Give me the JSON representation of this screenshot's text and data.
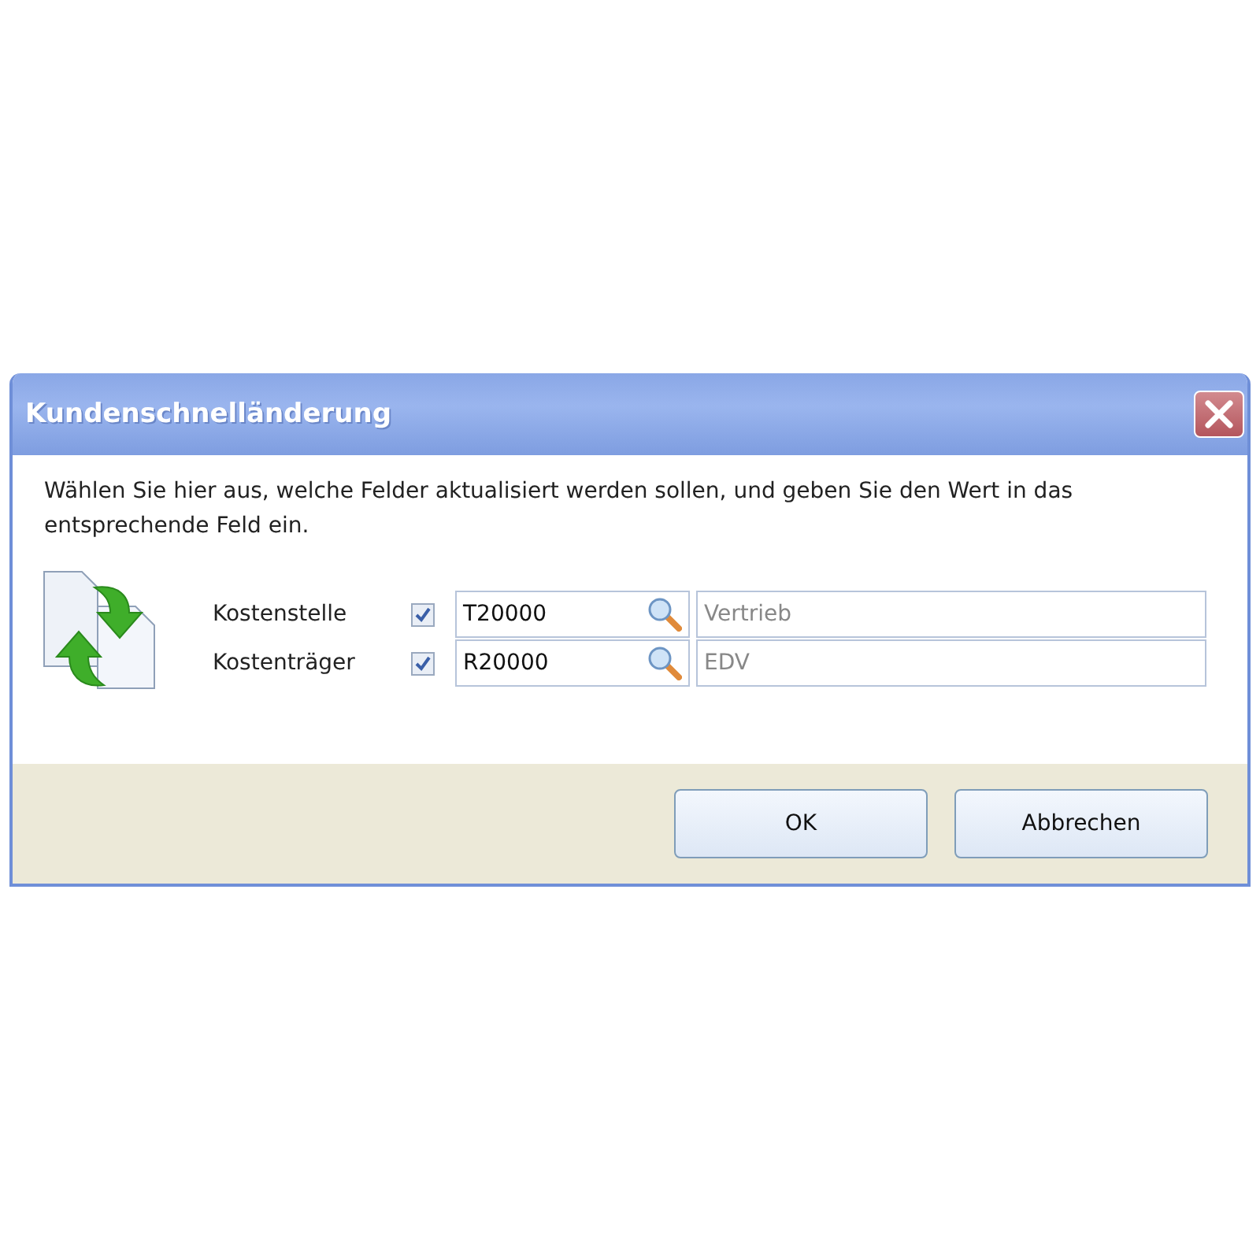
{
  "window": {
    "title": "Kundenschnelländerung"
  },
  "instruction": "Wählen Sie hier aus, welche Felder aktualisiert werden sollen, und geben Sie den Wert in das entsprechende Feld ein.",
  "fields": [
    {
      "label": "Kostenstelle",
      "checked": true,
      "code": "T20000",
      "description": "Vertrieb"
    },
    {
      "label": "Kostenträger",
      "checked": true,
      "code": "R20000",
      "description": "EDV"
    }
  ],
  "buttons": [
    "OK",
    "Abbrechen"
  ]
}
